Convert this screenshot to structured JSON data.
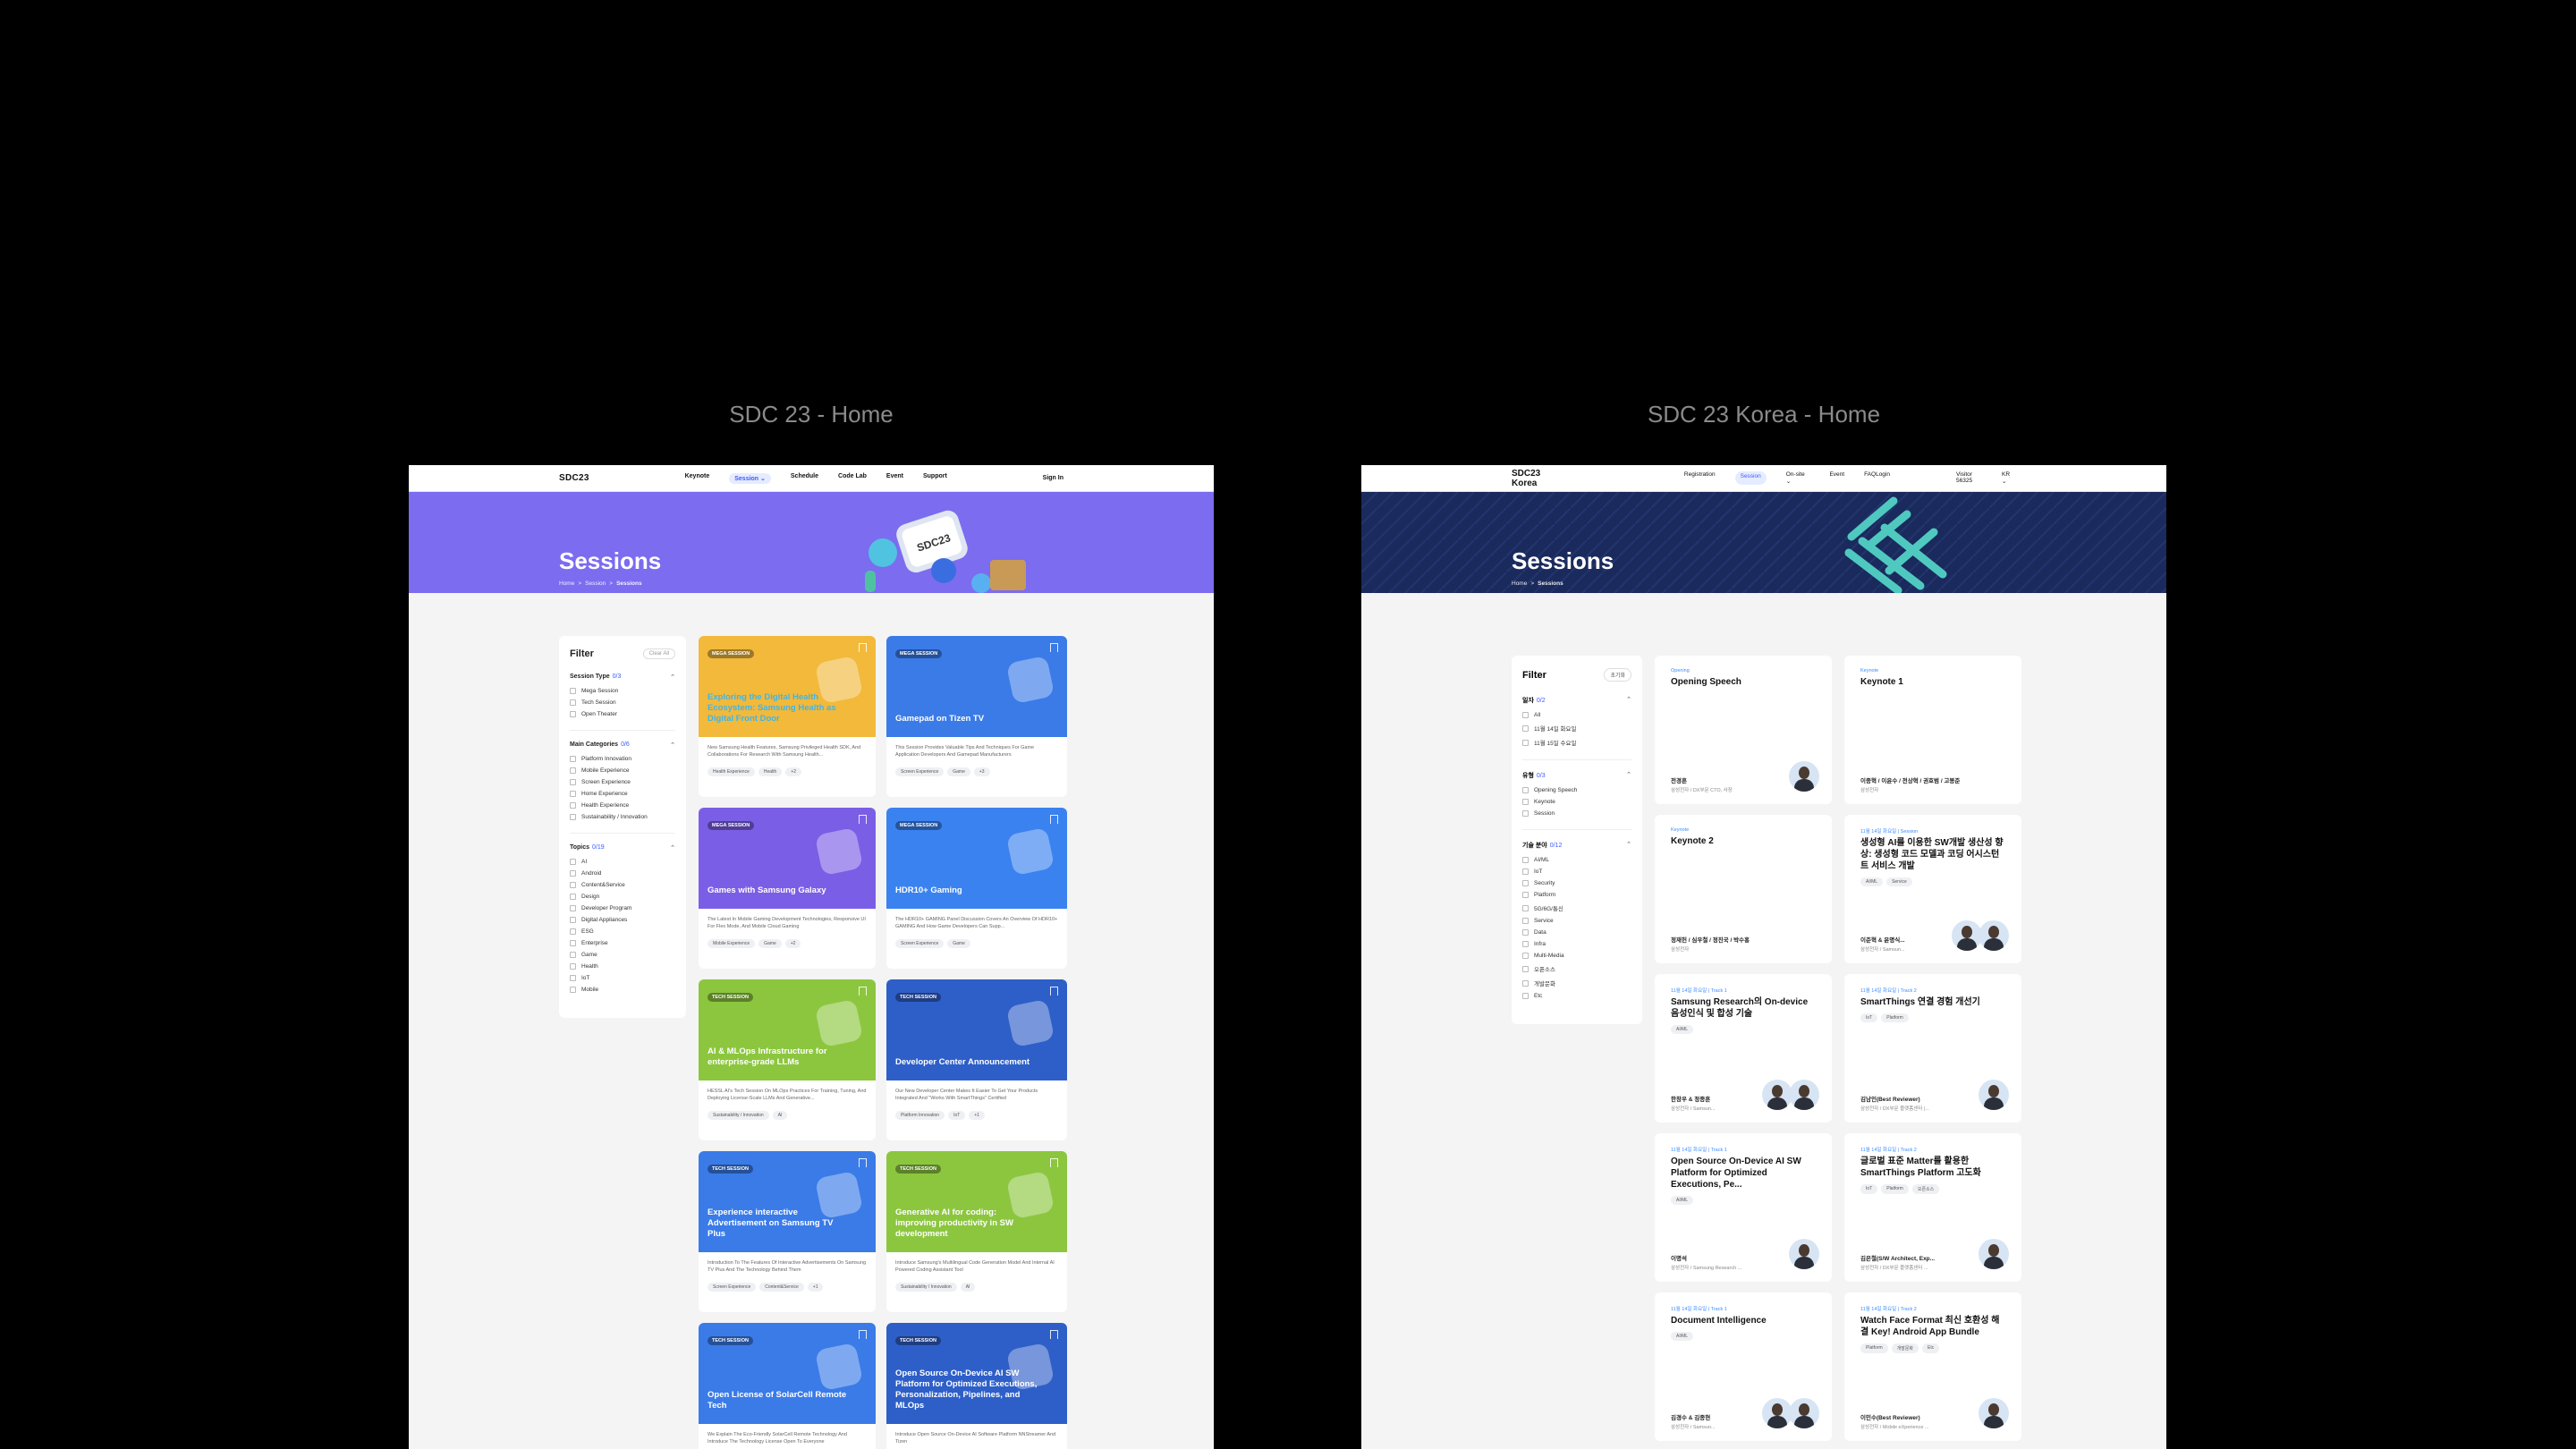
{
  "captions": {
    "left": "SDC 23 - Home",
    "right": "SDC 23 Korea - Home"
  },
  "sdc": {
    "logo": "SDC23",
    "nav": [
      "Keynote",
      "Session ⌄",
      "Schedule",
      "Code Lab",
      "Event",
      "Support"
    ],
    "sign_in": "Sign In",
    "hero_title": "Sessions",
    "crumb": [
      "Home",
      ">",
      "Session",
      ">",
      "Sessions"
    ],
    "hero_color": "#7b6cf0",
    "filter": {
      "title": "Filter",
      "clear": "Clear All",
      "groups": [
        {
          "name": "Session Type",
          "count": "0/3",
          "items": [
            "Mega Session",
            "Tech Session",
            "Open Theater"
          ]
        },
        {
          "name": "Main Categories",
          "count": "0/6",
          "items": [
            "Platform Innovation",
            "Mobile Experience",
            "Screen Experience",
            "Home Experience",
            "Health Experience",
            "Sustainability / Innovation"
          ]
        },
        {
          "name": "Topics",
          "count": "0/19",
          "items": [
            "AI",
            "Android",
            "Content&Service",
            "Design",
            "Developer Program",
            "Digital Appliances",
            "ESG",
            "Enterprise",
            "Game",
            "Health",
            "IoT",
            "Mobile"
          ]
        }
      ]
    },
    "cards": [
      {
        "badge": "MEGA SESSION",
        "title": "Exploring the Digital Health Ecosystem: Samsung Health as Digital Front Door",
        "desc": "New Samsung Health Features, Samsung Privileged Health SDK, And Collaborations For Research With Samsung Health...",
        "tags": [
          "Health Experience",
          "Health",
          "+2"
        ],
        "color": "#f2b93b",
        "title_color": "#3fb6e8"
      },
      {
        "badge": "MEGA SESSION",
        "title": "Gamepad on Tizen TV",
        "desc": "This Session Provides Valuable Tips And Techniques For Game Application Developers And Gamepad Manufacturers",
        "tags": [
          "Screen Experience",
          "Game",
          "+3"
        ],
        "color": "#3a7be8",
        "title_color": "#ffffff"
      },
      {
        "badge": "MEGA SESSION",
        "title": "Games with Samsung Galaxy",
        "desc": "The Latest In Mobile Gaming Development Technologies, Responsive UI For Flex Mode, And Mobile Cloud Gaming",
        "tags": [
          "Mobile Experience",
          "Game",
          "+2"
        ],
        "color": "#7b5ee6",
        "title_color": "#ffffff"
      },
      {
        "badge": "MEGA SESSION",
        "title": "HDR10+ Gaming",
        "desc": "The HDR10+ GAMING Panel Discussion Covers An Overview Of HDR10+ GAMING And How Game Developers Can Supp...",
        "tags": [
          "Screen Experience",
          "Game"
        ],
        "color": "#3a82f0",
        "title_color": "#ffffff"
      },
      {
        "badge": "TECH SESSION",
        "title": "AI & MLOps Infrastructure for enterprise-grade LLMs",
        "desc": "HESSL AI's Tech Session On MLOps Practices For Training, Tuning, And Deploying License-Scale LLMs And Generative...",
        "tags": [
          "Sustainability / Innovation",
          "AI"
        ],
        "color": "#8cc63f",
        "title_color": "#ffffff"
      },
      {
        "badge": "TECH SESSION",
        "title": "Developer Center Announcement",
        "desc": "Our New Developer Center Makes It Easier To Get Your Products Integrated And \"Works With SmartThings\" Certified",
        "tags": [
          "Platform Innovation",
          "IoT",
          "+1"
        ],
        "color": "#2e5fc8",
        "title_color": "#ffffff"
      },
      {
        "badge": "TECH SESSION",
        "title": "Experience interactive Advertisement on Samsung TV Plus",
        "desc": "Introduction To The Features Of Interactive Advertisements On Samsung TV Plus And The Technology Behind Them",
        "tags": [
          "Screen Experience",
          "Content&Service",
          "+1"
        ],
        "color": "#3a7be8",
        "title_color": "#ffffff"
      },
      {
        "badge": "TECH SESSION",
        "title": "Generative AI for coding: improving productivity in SW development",
        "desc": "Introduce Samsung's Multilingual Code Generation Model And Internal AI Powered Coding Assistant Tool",
        "tags": [
          "Sustainability / Innovation",
          "AI"
        ],
        "color": "#8cc63f",
        "title_color": "#ffffff"
      },
      {
        "badge": "TECH SESSION",
        "title": "Open License of SolarCell Remote Tech",
        "desc": "We Explain The Eco-Friendly SolarCell Remote Technology And Introduce The Technology License Open To Everyone",
        "tags": [],
        "color": "#3a7be8",
        "title_color": "#ffffff"
      },
      {
        "badge": "TECH SESSION",
        "title": "Open Source On-Device AI SW Platform for Optimized Executions, Personalization, Pipelines, and MLOps",
        "desc": "Introduce Open Source On-Device AI Software Platform NNStreamer And Tizen",
        "tags": [],
        "color": "#2e5fc8",
        "title_color": "#ffffff"
      }
    ]
  },
  "korea": {
    "logo": "SDC23 Korea",
    "nav": [
      "Registration",
      "Session",
      "On-site ⌄",
      "Event",
      "FAQ"
    ],
    "login": "Login",
    "visitor": "Visitor 56325",
    "lang": "KR ⌄",
    "hero_title": "Sessions",
    "crumb": [
      "Home",
      ">",
      "Sessions"
    ],
    "hero_color": "#1a2a5c",
    "accent": "#4fc9c0",
    "filter": {
      "title": "Filter",
      "clear": "초기화",
      "groups": [
        {
          "name": "일자",
          "count": "0/2",
          "items": [
            "All",
            "11월 14일 화요일",
            "11월 15일 수요일"
          ]
        },
        {
          "name": "유형",
          "count": "0/3",
          "items": [
            "Opening Speech",
            "Keynote",
            "Session"
          ]
        },
        {
          "name": "기술 분야",
          "count": "0/12",
          "items": [
            "AI/ML",
            "IoT",
            "Security",
            "Platform",
            "5G/6G/통신",
            "Service",
            "Data",
            "Infra",
            "Multi-Media",
            "오픈소스",
            "개발문화",
            "Etc"
          ]
        }
      ]
    },
    "cards": [
      {
        "type": "Opening",
        "title": "Opening Speech",
        "tags": [],
        "speaker": "전경훈",
        "org": "삼성전자 / DX부문 CTO, 사장",
        "avatars": 1
      },
      {
        "type": "Keynote",
        "title": "Keynote 1",
        "tags": [],
        "speaker": "이종혁 / 이윤수 / 전상혁 / 권호범 / 고봉준",
        "org": "삼성전자",
        "avatars": 0
      },
      {
        "type": "Keynote",
        "title": "Keynote 2",
        "tags": [],
        "speaker": "정재헌 / 심우철 / 정진국 / 박수홍",
        "org": "삼성전자",
        "avatars": 0
      },
      {
        "type": "11월 14일 화요일 | Session",
        "title": "생성형 AI를 이용한 SW개발 생산성 향상: 생성형 코드 모델과 코딩 어시스턴트 서비스 개발",
        "tags": [
          "AI/ML",
          "Service"
        ],
        "speaker": "이준혁 & 윤명식...",
        "org": "삼성전자 / Samsun...",
        "avatars": 2
      },
      {
        "type": "11월 14일 화요일 | Track 1",
        "title": "Samsung Research의 On-device 음성인식 및 합성 기술",
        "tags": [
          "AI/ML"
        ],
        "speaker": "한창우 & 정종훈",
        "org": "삼성전자 / Samsun...",
        "avatars": 2
      },
      {
        "type": "11월 14일 화요일 | Track 2",
        "title": "SmartThings 연결 경험 개선기",
        "tags": [
          "IoT",
          "Platform"
        ],
        "speaker": "김남인(Best Reviewer)",
        "org": "삼성전자 / DX부문 플랫폼센터 |...",
        "avatars": 1
      },
      {
        "type": "11월 14일 화요일 | Track 1",
        "title": "Open Source On-Device AI SW Platform for Optimized Executions, Pe...",
        "tags": [
          "AI/ML"
        ],
        "speaker": "이명석",
        "org": "삼성전자 / Samsung Research ...",
        "avatars": 1
      },
      {
        "type": "11월 14일 화요일 | Track 2",
        "title": "글로벌 표준 Matter를 활용한 SmartThings Platform 고도화",
        "tags": [
          "IoT",
          "Platform",
          "오픈소스"
        ],
        "speaker": "김은철(S/W Architect, Exp...",
        "org": "삼성전자 / DX부문 플랫폼센터 ...",
        "avatars": 1
      },
      {
        "type": "11월 14일 화요일 | Track 1",
        "title": "Document Intelligence",
        "tags": [
          "AI/ML"
        ],
        "speaker": "김경수 & 김종현",
        "org": "삼성전자 / Samsun...",
        "avatars": 2
      },
      {
        "type": "11월 14일 화요일 | Track 2",
        "title": "Watch Face Format 최신 호환성 해결 Key! Android App Bundle",
        "tags": [
          "Platform",
          "개발문화",
          "Etc"
        ],
        "speaker": "이민수(Best Reviewer)",
        "org": "삼성전자 / Mobile eXperience ...",
        "avatars": 1
      }
    ]
  }
}
